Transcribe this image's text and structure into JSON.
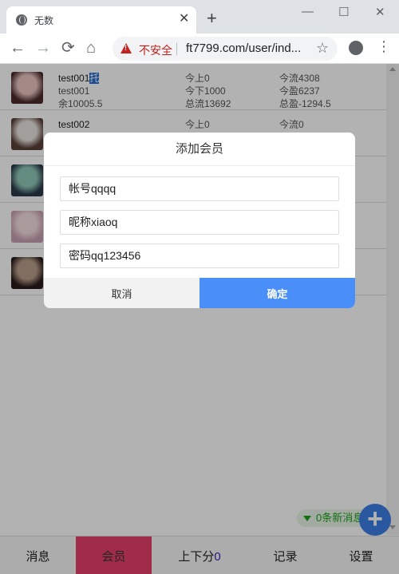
{
  "browser": {
    "tab_title": "无数",
    "tab_close": "✕",
    "new_tab": "+",
    "win_minimize": "—",
    "win_maximize": "☐",
    "win_close": "✕",
    "back": "←",
    "forward": "→",
    "reload": "⟳",
    "home": "⌂",
    "insecure_label": "不安全",
    "url": "ft7799.com/user/ind...",
    "bookmark": "☆",
    "menu": "⋮"
  },
  "members": [
    {
      "name": "test001",
      "name_highlight": "托",
      "account": "test001",
      "balance": "余10005.5",
      "today_up": "今上0",
      "today_down": "今下1000",
      "total_flow": "总流13692",
      "today_flow": "今流4308",
      "today_profit": "今盈6237",
      "total_profit": "总盈-1294.5",
      "avatar_colors": [
        "#e8c4c0",
        "#4a2a2a"
      ]
    },
    {
      "name": "test002",
      "name_highlight": "",
      "account": "",
      "balance": "",
      "today_up": "今上0",
      "today_down": "",
      "total_flow": "",
      "today_flow": "今流0",
      "today_profit": "",
      "total_profit": "",
      "avatar_colors": [
        "#e9e3de",
        "#5a4038"
      ]
    },
    {
      "name": "",
      "name_highlight": "",
      "account": "",
      "balance": "",
      "today_up": "",
      "today_down": "",
      "total_flow": "",
      "today_flow": "",
      "today_profit": "",
      "total_profit": "",
      "avatar_colors": [
        "#8fc8b8",
        "#2a3a4a"
      ]
    },
    {
      "name": "",
      "name_highlight": "",
      "account": "",
      "balance": "",
      "today_up": "",
      "today_down": "",
      "total_flow": "",
      "today_flow": "",
      "today_profit": "",
      "total_profit": "",
      "avatar_colors": [
        "#f2dede",
        "#c8a0b0"
      ]
    },
    {
      "name": "",
      "name_highlight": "",
      "account": "",
      "balance": "",
      "today_up": "",
      "today_down": "",
      "total_flow": "",
      "today_flow": "",
      "today_profit": "",
      "total_profit": "",
      "avatar_colors": [
        "#b8a08a",
        "#2a1a1a"
      ]
    }
  ],
  "message_toggle": "0条新消息",
  "fab_label": "+",
  "bottom_nav": [
    {
      "label": "消息",
      "count": ""
    },
    {
      "label": "会员",
      "count": ""
    },
    {
      "label": "上下分",
      "count": "0"
    },
    {
      "label": "记录",
      "count": ""
    },
    {
      "label": "设置",
      "count": ""
    }
  ],
  "modal": {
    "title": "添加会员",
    "account_value": "帐号qqqq",
    "nickname_value": "昵称xiaoq",
    "password_value": "密码qq123456",
    "cancel_label": "取消",
    "ok_label": "确定"
  },
  "colors": {
    "active_nav": "#e6406a",
    "ok_button": "#4a8ff7",
    "fab": "#3b7de6",
    "message_green": "#1aa11a"
  }
}
